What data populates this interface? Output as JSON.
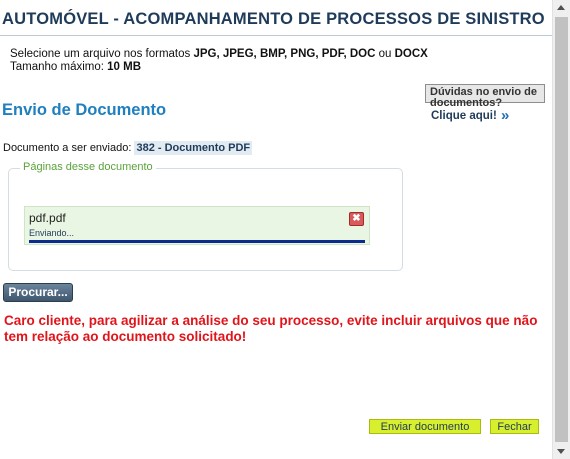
{
  "header": {
    "title": "AUTOMÓVEL - ACOMPANHAMENTO DE PROCESSOS DE SINISTRO"
  },
  "instructions": {
    "formats_prefix": "Selecione um arquivo nos formatos ",
    "formats_list": "JPG, JPEG, BMP, PNG, PDF, DOC",
    "formats_ou": " ou ",
    "formats_last": "DOCX",
    "max_size_label": "Tamanho máximo: ",
    "max_size_value": "10 MB"
  },
  "section": {
    "title": "Envio de Documento"
  },
  "help": {
    "box_text": "Dúvidas no envio de documentos?",
    "link_text": "Clique aqui!",
    "chevron": "»"
  },
  "document": {
    "label": "Documento a ser enviado: ",
    "value": "382 - Documento PDF"
  },
  "pages": {
    "legend": "Páginas desse documento",
    "items": [
      {
        "file_name": "pdf.pdf",
        "status": "Enviando...",
        "progress_fraction": 1.0,
        "remove_glyph": "✖"
      }
    ]
  },
  "browse_button": {
    "label": "Procurar..."
  },
  "warning": {
    "text": "Caro cliente, para agilizar a análise do seu processo, evite incluir arquivos que não tem relação ao documento solicitado!"
  },
  "footer": {
    "send_label": "Enviar documento",
    "close_label": "Fechar"
  },
  "colors": {
    "title": "#1f3b5a",
    "section": "#1f7fbf",
    "warning": "#e0141a",
    "button_green": "#d8ef2d",
    "legend": "#5aa33a"
  }
}
